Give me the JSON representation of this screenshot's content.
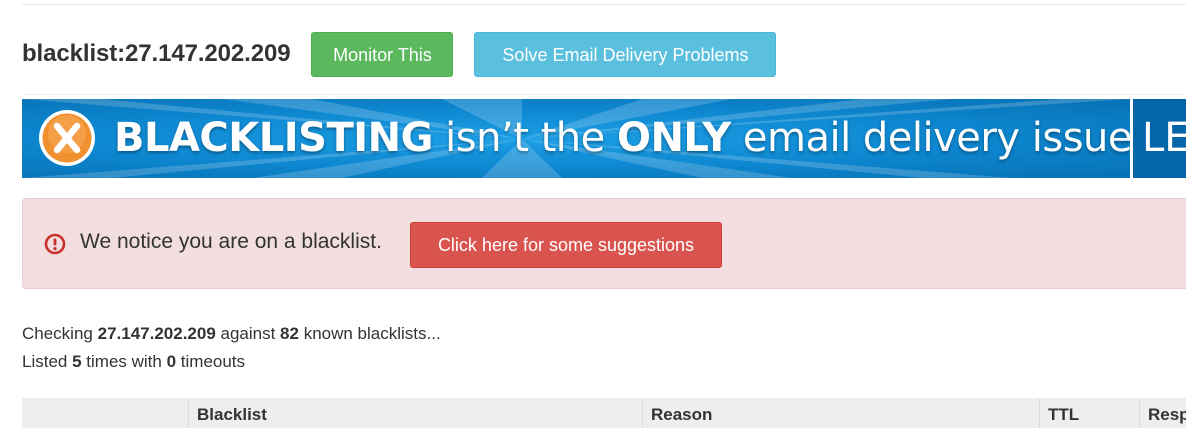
{
  "header": {
    "title": "blacklist:27.147.202.209",
    "monitor_label": "Monitor This",
    "solve_label": "Solve Email Delivery Problems"
  },
  "banner": {
    "part1": "BLACKLISTING",
    "part2": " isn’t the ",
    "part3": "ONLY",
    "part4": " email delivery issue",
    "right_text": "LE",
    "icon": "x-circle-icon"
  },
  "alert": {
    "icon": "exclamation-circle-icon",
    "message": "We notice you are on a blacklist.",
    "button_label": "Click here for some suggestions"
  },
  "status": {
    "checking_prefix": "Checking ",
    "ip": "27.147.202.209",
    "against": " against ",
    "count": "82",
    "suffix": " known blacklists...",
    "listed_prefix": "Listed ",
    "listed_count": "5",
    "times_with": " times with ",
    "timeouts_count": "0",
    "timeouts_suffix": " timeouts"
  },
  "table": {
    "columns": [
      "",
      "Blacklist",
      "Reason",
      "TTL",
      "Resp"
    ]
  },
  "colors": {
    "green": "#5cb85c",
    "blue": "#5bc0de",
    "red": "#d9534f",
    "alert_bg": "#f2dede",
    "banner_blue": "#0d86cf",
    "banner_orange": "#f0902e"
  }
}
